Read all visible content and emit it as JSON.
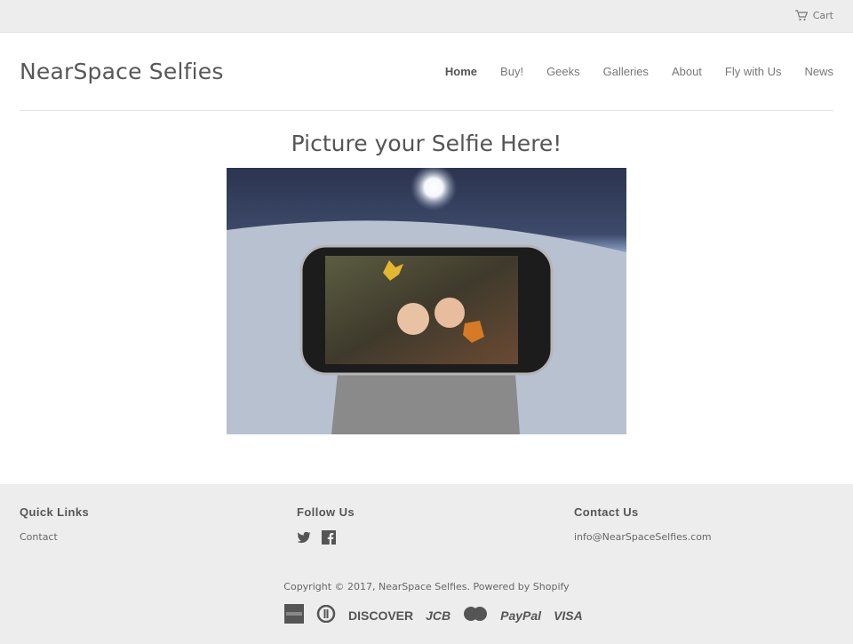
{
  "topbar": {
    "cart_label": "Cart",
    "cart_icon": "cart-icon"
  },
  "header": {
    "site_title": "NearSpace Selfies",
    "nav": [
      {
        "label": "Home",
        "active": true
      },
      {
        "label": "Buy!"
      },
      {
        "label": "Geeks"
      },
      {
        "label": "Galleries"
      },
      {
        "label": "About"
      },
      {
        "label": "Fly with Us"
      },
      {
        "label": "News"
      }
    ]
  },
  "main": {
    "title": "Picture your Selfie Here!",
    "hero_image": "phone-selfie-in-near-space-image"
  },
  "footer": {
    "quick_links": {
      "heading": "Quick Links",
      "items": [
        "Contact"
      ]
    },
    "follow_us": {
      "heading": "Follow Us",
      "icons": [
        "twitter-icon",
        "facebook-icon"
      ]
    },
    "contact_us": {
      "heading": "Contact Us",
      "email": "info@NearSpaceSelfies.com"
    },
    "copyright_prefix": "Copyright © 2017, ",
    "copyright_site": "NearSpace Selfies",
    "copyright_sep": ". ",
    "powered_by": "Powered by Shopify",
    "payments": [
      "American Express",
      "Diners Club",
      "DISCOVER",
      "JCB",
      "MasterCard",
      "PayPal",
      "VISA"
    ]
  }
}
